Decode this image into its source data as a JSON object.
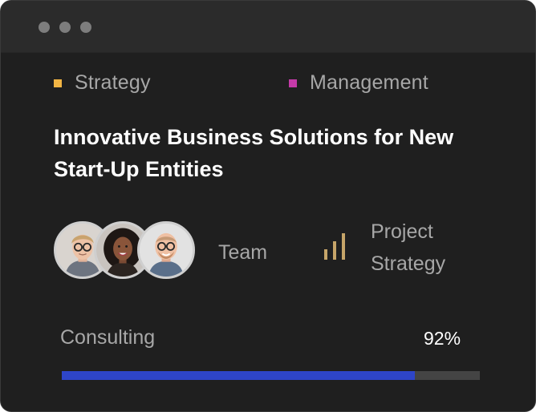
{
  "window": {
    "dots": [
      "window-dot-1",
      "window-dot-2",
      "window-dot-3"
    ]
  },
  "tags": [
    {
      "label": "Strategy",
      "color": "#f2b544"
    },
    {
      "label": "Management",
      "color": "#c43aa8"
    }
  ],
  "headline": "Innovative Business Solutions for New Start-Up Entities",
  "team": {
    "label": "Team",
    "avatars": [
      {
        "name": "avatar-man-glasses-blond"
      },
      {
        "name": "avatar-woman-curly-hair"
      },
      {
        "name": "avatar-man-glasses-bald"
      }
    ]
  },
  "project": {
    "icon": "signal-bars-icon",
    "icon_color": "#c6a569",
    "line1": "Project",
    "line2": "Strategy"
  },
  "progress": {
    "label": "Consulting",
    "percent_text": "92%",
    "value": 0.845,
    "fill_color": "#2e45c8",
    "track_color": "#444444"
  }
}
